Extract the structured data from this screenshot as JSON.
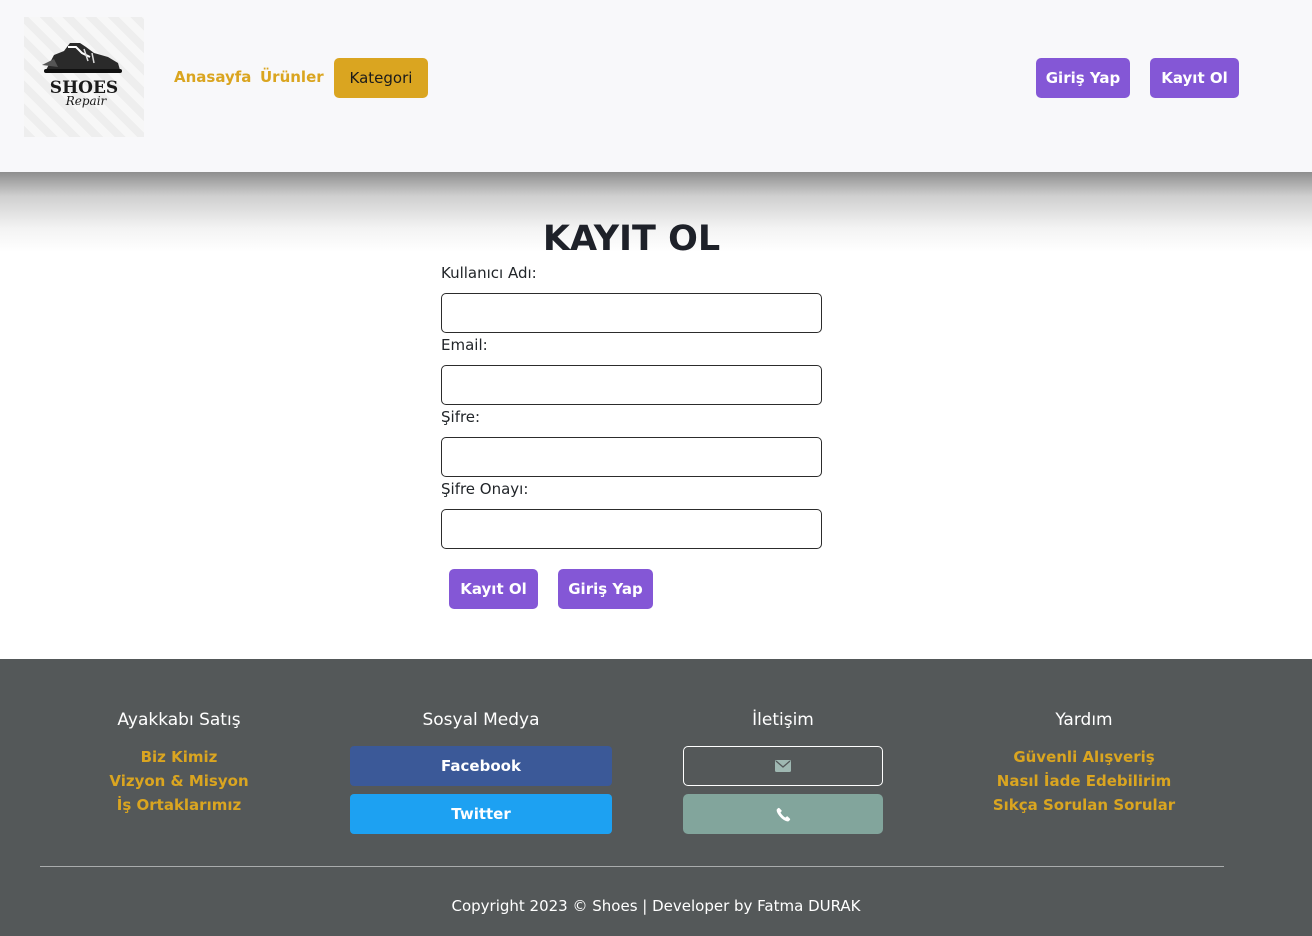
{
  "header": {
    "logo": {
      "line1": "SHOES",
      "line2": "Repair"
    },
    "nav": {
      "home": "Anasayfa",
      "products": "Ürünler",
      "category": "Kategori"
    },
    "login_label": "Giriş Yap",
    "register_label": "Kayıt Ol"
  },
  "form": {
    "title": "KAYIT OL",
    "username_label": "Kullanıcı Adı:",
    "email_label": "Email:",
    "password_label": "Şifre:",
    "password_confirm_label": "Şifre Onayı:",
    "username_value": "",
    "email_value": "",
    "password_value": "",
    "password_confirm_value": "",
    "register_button": "Kayıt Ol",
    "login_button": "Giriş Yap"
  },
  "footer": {
    "col1": {
      "title": "Ayakkabı Satış",
      "links": [
        "Biz Kimiz",
        "Vizyon & Misyon",
        "İş Ortaklarımız"
      ]
    },
    "col2": {
      "title": "Sosyal Medya",
      "facebook": "Facebook",
      "twitter": "Twitter"
    },
    "col3": {
      "title": "İletişim",
      "mail_icon": "envelope-icon",
      "phone_icon": "phone-icon"
    },
    "col4": {
      "title": "Yardım",
      "links": [
        "Güvenli Alışveriş",
        "Nasıl İade Edebilirim",
        "Sıkça Sorulan Sorular"
      ]
    },
    "copyright": "Copyright 2023 © Shoes | Developer by Fatma DURAK"
  },
  "colors": {
    "accent_gold": "#daa520",
    "accent_purple": "#8457d6",
    "footer_bg": "#545859",
    "facebook": "#3b5998",
    "twitter": "#1da1f2",
    "phone_button": "#82a59c"
  }
}
